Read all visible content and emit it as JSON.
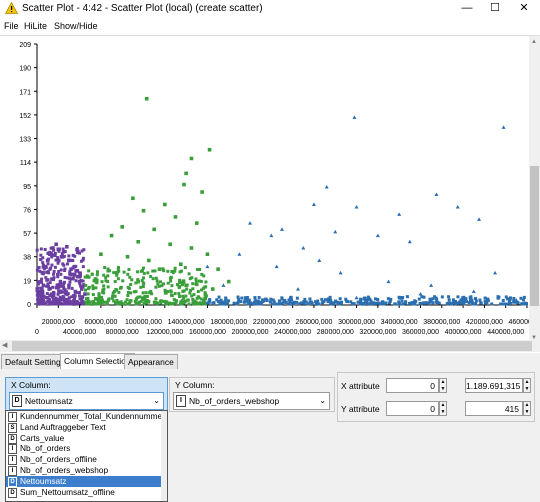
{
  "window": {
    "title": "Scatter Plot - 4:42 - Scatter Plot (local) (create scatter)",
    "minimize": "—",
    "maximize": "☐",
    "close": "✕"
  },
  "menu": [
    "File",
    "HiLite",
    "Show/Hide"
  ],
  "chart_data": {
    "type": "scatter",
    "x_ticks": [
      "0",
      "20000,000",
      "40000,000",
      "60000,000",
      "80000,000",
      "100000,000",
      "120000,000",
      "140000,000",
      "160000,000",
      "180000,000",
      "200000,000",
      "220000,000",
      "240000,000",
      "260000,000",
      "280000,000",
      "300000,000",
      "320000,000",
      "340000,000",
      "360000,000",
      "380000,000",
      "400000,000",
      "420000,000",
      "440000,000",
      "460000,000"
    ],
    "y_ticks": [
      "0",
      "19",
      "38",
      "57",
      "76",
      "95",
      "114",
      "133",
      "152",
      "171",
      "190",
      "209"
    ],
    "xlim": [
      0,
      460000000
    ],
    "ylim": [
      0,
      209
    ],
    "series": [
      {
        "color": "#6a3fa0",
        "marker": "square",
        "points": [
          [
            2000000,
            10
          ],
          [
            5000000,
            25
          ],
          [
            8000000,
            30
          ],
          [
            10000000,
            35
          ],
          [
            12000000,
            40
          ],
          [
            15000000,
            45
          ],
          [
            18000000,
            48
          ],
          [
            20000000,
            44
          ],
          [
            23000000,
            38
          ],
          [
            25000000,
            42
          ],
          [
            28000000,
            46
          ],
          [
            30000000,
            35
          ],
          [
            32000000,
            28
          ],
          [
            35000000,
            30
          ],
          [
            38000000,
            22
          ],
          [
            40000000,
            18
          ],
          [
            42000000,
            12
          ],
          [
            45000000,
            8
          ],
          [
            6000000,
            15
          ],
          [
            14000000,
            20
          ],
          [
            22000000,
            18
          ],
          [
            30000000,
            15
          ],
          [
            36000000,
            10
          ],
          [
            10000000,
            5
          ],
          [
            20000000,
            3
          ]
        ]
      },
      {
        "color": "#3a9e3a",
        "marker": "square",
        "points": [
          [
            103000000,
            165
          ],
          [
            145000000,
            117
          ],
          [
            162000000,
            124
          ],
          [
            140000000,
            105
          ],
          [
            138000000,
            96
          ],
          [
            155000000,
            90
          ],
          [
            120000000,
            80
          ],
          [
            90000000,
            85
          ],
          [
            100000000,
            75
          ],
          [
            130000000,
            70
          ],
          [
            150000000,
            65
          ],
          [
            110000000,
            60
          ],
          [
            80000000,
            62
          ],
          [
            70000000,
            55
          ],
          [
            95000000,
            50
          ],
          [
            125000000,
            48
          ],
          [
            145000000,
            45
          ],
          [
            160000000,
            40
          ],
          [
            60000000,
            40
          ],
          [
            85000000,
            38
          ],
          [
            105000000,
            35
          ],
          [
            135000000,
            32
          ],
          [
            115000000,
            28
          ],
          [
            75000000,
            25
          ],
          [
            55000000,
            20
          ],
          [
            95000000,
            18
          ],
          [
            140000000,
            15
          ],
          [
            165000000,
            12
          ],
          [
            180000000,
            18
          ],
          [
            170000000,
            28
          ]
        ]
      },
      {
        "color": "#2b6fb0",
        "marker": "triangle",
        "points": [
          [
            298000000,
            150
          ],
          [
            438000000,
            142
          ],
          [
            272000000,
            94
          ],
          [
            375000000,
            88
          ],
          [
            260000000,
            80
          ],
          [
            300000000,
            78
          ],
          [
            340000000,
            72
          ],
          [
            395000000,
            78
          ],
          [
            415000000,
            68
          ],
          [
            200000000,
            65
          ],
          [
            230000000,
            60
          ],
          [
            280000000,
            58
          ],
          [
            320000000,
            55
          ],
          [
            350000000,
            50
          ],
          [
            250000000,
            45
          ],
          [
            190000000,
            40
          ],
          [
            225000000,
            30
          ],
          [
            285000000,
            25
          ],
          [
            330000000,
            18
          ],
          [
            430000000,
            25
          ],
          [
            370000000,
            15
          ],
          [
            410000000,
            10
          ],
          [
            265000000,
            35
          ],
          [
            220000000,
            55
          ],
          [
            160000000,
            30
          ],
          [
            175000000,
            15
          ],
          [
            245000000,
            12
          ],
          [
            300000000,
            5
          ],
          [
            360000000,
            8
          ],
          [
            450000000,
            3
          ]
        ]
      }
    ],
    "dense_fill": [
      {
        "color": "#6a3fa0",
        "x": [
          0,
          45000000
        ],
        "y": [
          0,
          45
        ]
      },
      {
        "color": "#3a9e3a",
        "x": [
          45000000,
          160000000
        ],
        "y": [
          0,
          30
        ]
      },
      {
        "color": "#2b6fb0",
        "x": [
          160000000,
          460000000
        ],
        "y": [
          0,
          6
        ]
      }
    ]
  },
  "tabs": [
    "Default Settings",
    "Column Selection",
    "Appearance"
  ],
  "active_tab": "Column Selection",
  "x_column": {
    "label": "X Column:",
    "type": "D",
    "value": "Nettoumsatz"
  },
  "y_column": {
    "label": "Y Column:",
    "type": "I",
    "value": "Nb_of_orders_webshop"
  },
  "x_attribute": {
    "label": "X attribute",
    "min": "0",
    "max": "1.189.691,315"
  },
  "y_attribute": {
    "label": "Y attribute",
    "min": "0",
    "max": "415"
  },
  "dropdown_items": [
    {
      "type": "I",
      "label": "Kundennummer_Total_Kundennummer"
    },
    {
      "type": "S",
      "label": "Land Auftraggeber Text"
    },
    {
      "type": "D",
      "label": "Carts_value"
    },
    {
      "type": "I",
      "label": "Nb_of_orders"
    },
    {
      "type": "I",
      "label": "Nb_of_orders_offline"
    },
    {
      "type": "I",
      "label": "Nb_of_orders_webshop"
    },
    {
      "type": "D",
      "label": "Nettoumsatz"
    },
    {
      "type": "D",
      "label": "Sum_Nettoumsatz_offline"
    }
  ],
  "selected_index": 6
}
